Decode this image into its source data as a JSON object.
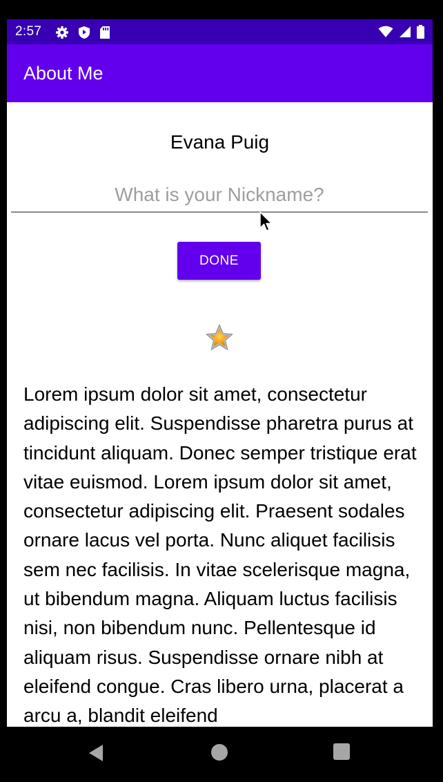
{
  "status_bar": {
    "time": "2:57",
    "icons": [
      "gear-icon",
      "shield-icon",
      "sd-card-icon",
      "wifi-icon",
      "signal-icon",
      "battery-icon"
    ],
    "color": "#3700b3"
  },
  "app_bar": {
    "title": "About Me",
    "color": "#6200ee"
  },
  "main": {
    "name": "Evana Puig",
    "nickname_input": {
      "value": "",
      "placeholder": "What is your Nickname?"
    },
    "done_button": {
      "label": "DONE",
      "color": "#6200ee"
    },
    "star_icon": "star-icon",
    "bio": "Lorem ipsum dolor sit amet, consectetur adipiscing elit. Suspendisse pharetra purus at tincidunt aliquam. Donec semper tristique erat vitae euismod. Lorem ipsum dolor sit amet, consectetur adipiscing elit. Praesent sodales ornare lacus vel porta. Nunc aliquet facilisis sem nec facilisis. In vitae scelerisque magna, ut bibendum magna. Aliquam luctus facilisis nisi, non bibendum nunc. Pellentesque id aliquam risus. Suspendisse ornare nibh at eleifend congue. Cras libero urna, placerat a arcu a, blandit eleifend"
  },
  "nav_bar": {
    "icons": [
      "back-icon",
      "home-icon",
      "recents-icon"
    ]
  }
}
